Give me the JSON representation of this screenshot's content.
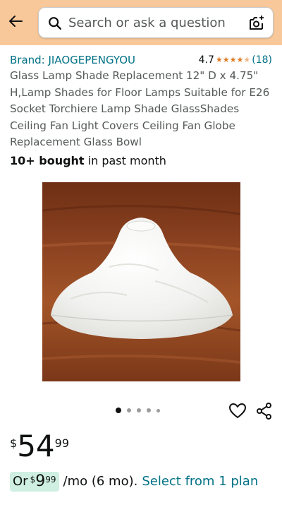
{
  "header": {
    "back_icon": "arrow-left-icon",
    "search_placeholder": "Search or ask a question",
    "lens_icon": "camera-search-icon",
    "bg_color": "#F8C89A"
  },
  "product": {
    "brand": "Brand: JIAOGEPENGYOU",
    "rating": "4.7",
    "rating_stars": 4.5,
    "rating_count": "(18)",
    "title": "Glass Lamp Shade Replacement 12\" D x 4.75\" H,Lamp Shades for Floor Lamps Suitable for E26 Socket Torchiere Lamp Shade GlassShades Ceiling Fan Light Covers Ceiling Fan Globe Replacement Glass Bowl",
    "bought_bold": "10+ bought",
    "bought_rest": " in past month"
  },
  "gallery": {
    "image": "white frosted alabaster glass bell-shaped lamp shade on wooden surface",
    "dot_count": 5,
    "active_dot": 1,
    "heart_icon": "heart-icon",
    "share_icon": "share-icon"
  },
  "price": {
    "symbol": "$",
    "whole": "54",
    "fraction": "99"
  },
  "plan": {
    "prefix": "Or",
    "symbol": "$",
    "whole": "9",
    "fraction": "99",
    "suffix": "/mo (6 mo).",
    "link": "Select from 1 plan"
  },
  "colors": {
    "link": "#007185",
    "star": "#DE7921",
    "plan_pill": "#CFEFE3"
  }
}
